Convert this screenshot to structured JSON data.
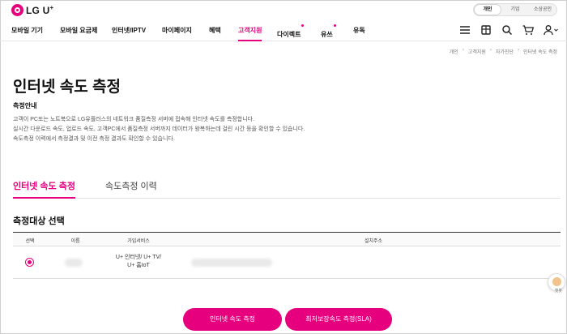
{
  "brand": {
    "logo_text": "LG U",
    "logo_sup": "+",
    "accent": "#e6007e"
  },
  "segment": {
    "items": [
      "개인",
      "기업",
      "소상공인"
    ],
    "active": 0
  },
  "gnb": {
    "items": [
      {
        "label": "모바일 기기",
        "dot": false
      },
      {
        "label": "모바일 요금제",
        "dot": false
      },
      {
        "label": "인터넷/IPTV",
        "dot": false
      },
      {
        "label": "마이페이지",
        "dot": false
      },
      {
        "label": "혜택",
        "dot": false
      },
      {
        "label": "고객지원",
        "dot": false,
        "active": true
      },
      {
        "label": "다이렉트",
        "dot": true
      },
      {
        "label": "유쓰",
        "dot": true
      },
      {
        "label": "유독",
        "dot": false
      }
    ],
    "utility_icons": [
      "menu-icon",
      "store-icon",
      "search-icon",
      "cart-icon",
      "user-icon"
    ]
  },
  "breadcrumb": [
    "개인",
    "고객지원",
    "자가진단",
    "인터넷 속도 측정"
  ],
  "page": {
    "title": "인터넷 속도 측정",
    "guide_label": "측정안내",
    "desc_lines": [
      "고객이 PC또는 노트북으로 LG유플러스의 네트워크 품질측정 서버에 접속해 인터넷 속도를 측정합니다.",
      "실시간 다운로드 속도, 업로드 속도, 고객PC에서 품질측정 서버까지 데이터가 왕복하는데 걸린 시간 등을 확인할 수 있습니다.",
      "속도측정 이력에서 측정결과 및 이전 측정 결과도 확인할 수 있습니다."
    ]
  },
  "tabs": [
    {
      "label": "인터넷 속도 측정",
      "active": true
    },
    {
      "label": "속도측정 이력",
      "active": false
    }
  ],
  "select_section": {
    "title": "측정대상 선택",
    "headers": [
      "선택",
      "이름",
      "가입서비스",
      "설치주소"
    ],
    "rows": [
      {
        "selected": true,
        "service_lines": [
          "U+ 인터넷/ U+ TV/",
          "U+ 홈IoT"
        ]
      }
    ]
  },
  "buttons": {
    "measure": "인터넷 속도 측정",
    "sla": "최저보장속도 측정(SLA)"
  },
  "floating": {
    "label": "챗봇"
  }
}
